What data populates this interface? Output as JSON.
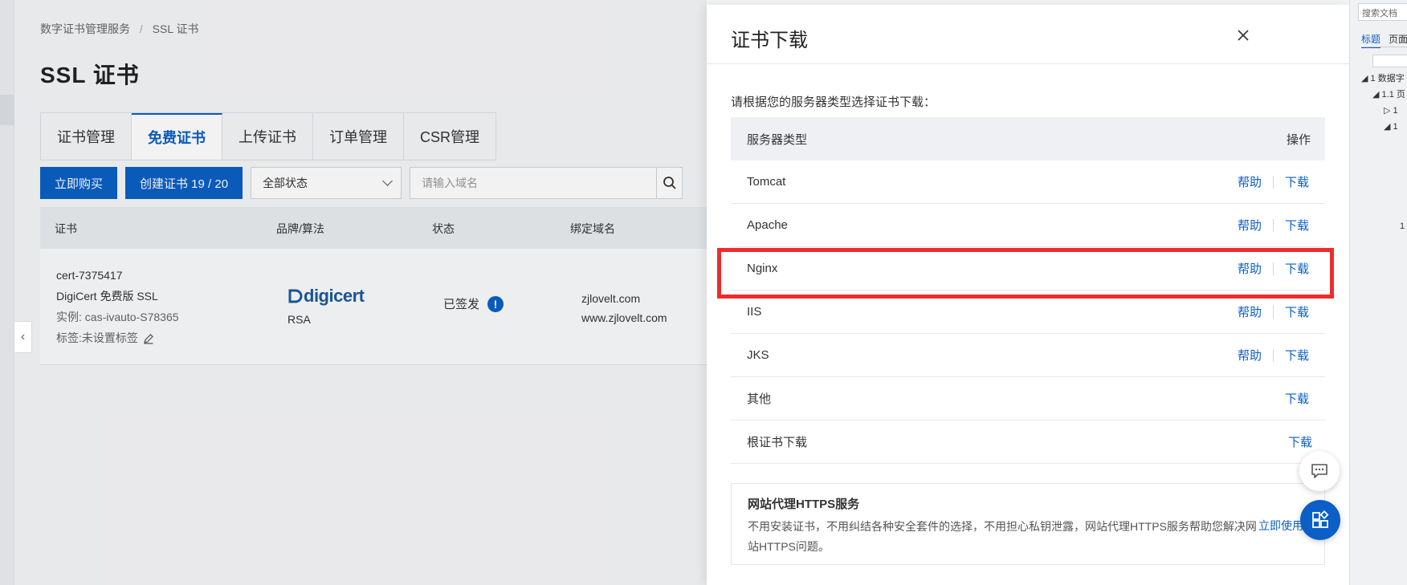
{
  "breadcrumb": {
    "parent": "数字证书管理服务",
    "separator": "/",
    "current": "SSL 证书"
  },
  "page": {
    "title": "SSL 证书"
  },
  "tabs": [
    {
      "label": "证书管理",
      "active": false
    },
    {
      "label": "免费证书",
      "active": true
    },
    {
      "label": "上传证书",
      "active": false
    },
    {
      "label": "订单管理",
      "active": false
    },
    {
      "label": "CSR管理",
      "active": false
    }
  ],
  "toolbar": {
    "buy_label": "立即购买",
    "create_label": "创建证书 19 / 20",
    "status_filter": "全部状态",
    "search_placeholder": "请输入域名"
  },
  "cert_table": {
    "headers": {
      "cert": "证书",
      "brand": "品牌/算法",
      "status": "状态",
      "domain": "绑定域名"
    },
    "row": {
      "cert_id": "cert-7375417",
      "cert_name": "DigiCert 免费版 SSL",
      "instance": "实例: cas-ivauto-S78365",
      "tag": "标签:未设置标签",
      "brand_logo": "digicert",
      "algorithm": "RSA",
      "status": "已签发",
      "domains": [
        "zjlovelt.com",
        "www.zjlovelt.com"
      ]
    }
  },
  "drawer": {
    "title": "证书下载",
    "instruction": "请根据您的服务器类型选择证书下载：",
    "table_headers": {
      "server_type": "服务器类型",
      "action": "操作"
    },
    "help_label": "帮助",
    "download_label": "下载",
    "rows": [
      {
        "server": "Tomcat",
        "has_help": true
      },
      {
        "server": "Apache",
        "has_help": true
      },
      {
        "server": "Nginx",
        "has_help": true,
        "highlighted": true
      },
      {
        "server": "IIS",
        "has_help": true
      },
      {
        "server": "JKS",
        "has_help": true
      },
      {
        "server": "其他",
        "has_help": false
      },
      {
        "server": "根证书下载",
        "has_help": false
      }
    ],
    "promo": {
      "title": "网站代理HTTPS服务",
      "description": "不用安装证书，不用纠结各种安全套件的选择，不用担心私钥泄露，网站代理HTTPS服务帮助您解决网站HTTPS问题。",
      "link": "立即使用"
    }
  },
  "doc_pane": {
    "search_placeholder": "搜索文档",
    "tab_active": "标题",
    "tab_inactive": "页面",
    "tree": [
      "◢ 1 数据字",
      "◢ 1.1 页",
      "▷ 1",
      "◢ 1"
    ],
    "number": "1"
  },
  "colors": {
    "accent": "#0b5fc5",
    "highlight": "#ee2b2b"
  }
}
